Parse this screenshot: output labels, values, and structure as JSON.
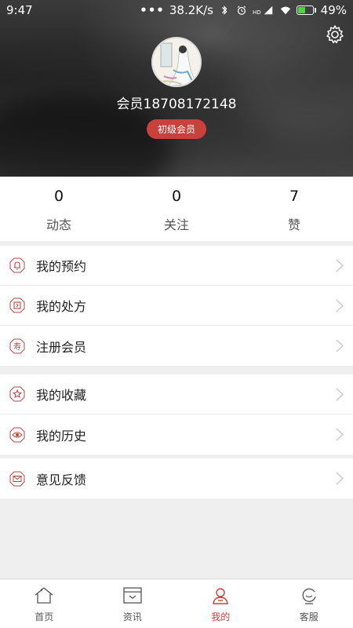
{
  "status_bar": {
    "time": "9:47",
    "dots": "•••",
    "speed": "38.2K/s",
    "hd_label": "HD",
    "battery": "49%",
    "battery_level": 0.49
  },
  "profile": {
    "username": "会员18708172148",
    "level_badge": "初级会员"
  },
  "stats": [
    {
      "value": "0",
      "label": "动态"
    },
    {
      "value": "0",
      "label": "关注"
    },
    {
      "value": "7",
      "label": "赞"
    }
  ],
  "menu": {
    "group1": [
      {
        "label": "我的预约",
        "icon": "bell-icon"
      },
      {
        "label": "我的处方",
        "icon": "prescription-icon"
      },
      {
        "label": "注册会员",
        "icon": "shou-icon",
        "icon_char": "寿"
      }
    ],
    "group2": [
      {
        "label": "我的收藏",
        "icon": "star-icon"
      },
      {
        "label": "我的历史",
        "icon": "eye-icon"
      }
    ],
    "group3": [
      {
        "label": "意见反馈",
        "icon": "mail-icon"
      }
    ]
  },
  "nav": [
    {
      "label": "首页",
      "icon": "home-icon"
    },
    {
      "label": "资讯",
      "icon": "news-icon"
    },
    {
      "label": "我的",
      "icon": "user-icon",
      "active": true
    },
    {
      "label": "客服",
      "icon": "service-icon"
    }
  ],
  "colors": {
    "accent": "#c9413c",
    "icon_red": "#b64540",
    "background": "#efefef"
  }
}
